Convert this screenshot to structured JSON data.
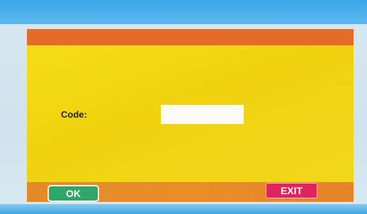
{
  "dialog": {
    "code_label": "Code:",
    "code_value": "",
    "ok_label": "OK",
    "exit_label": "EXIT"
  },
  "colors": {
    "header": "#e86a28",
    "panel": "#f3d81a",
    "footer": "#e98d2a",
    "ok_button": "#2fa66a",
    "exit_button": "#e0245e"
  }
}
